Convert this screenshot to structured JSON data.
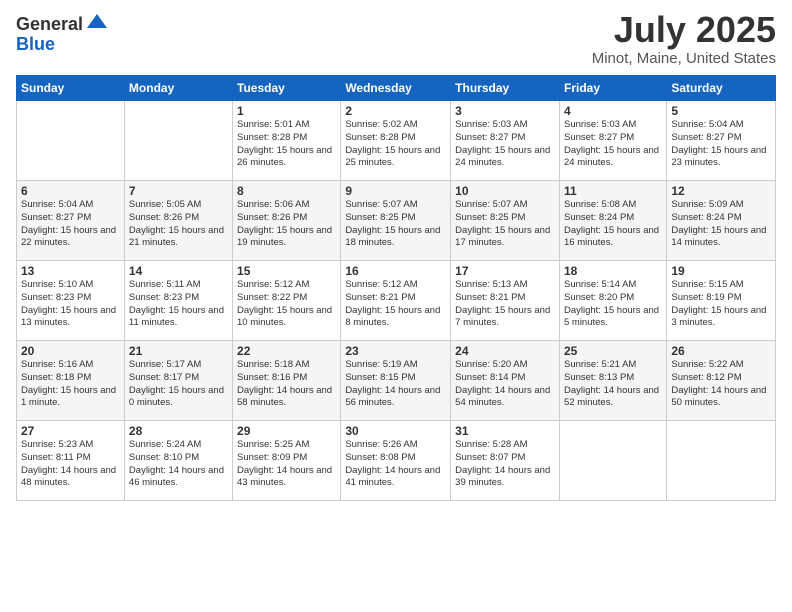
{
  "logo": {
    "general": "General",
    "blue": "Blue"
  },
  "title": {
    "month": "July 2025",
    "location": "Minot, Maine, United States"
  },
  "weekdays": [
    "Sunday",
    "Monday",
    "Tuesday",
    "Wednesday",
    "Thursday",
    "Friday",
    "Saturday"
  ],
  "weeks": [
    [
      null,
      null,
      {
        "day": "1",
        "sunrise": "5:01 AM",
        "sunset": "8:28 PM",
        "daylight": "15 hours and 26 minutes."
      },
      {
        "day": "2",
        "sunrise": "5:02 AM",
        "sunset": "8:28 PM",
        "daylight": "15 hours and 25 minutes."
      },
      {
        "day": "3",
        "sunrise": "5:03 AM",
        "sunset": "8:27 PM",
        "daylight": "15 hours and 24 minutes."
      },
      {
        "day": "4",
        "sunrise": "5:03 AM",
        "sunset": "8:27 PM",
        "daylight": "15 hours and 24 minutes."
      },
      {
        "day": "5",
        "sunrise": "5:04 AM",
        "sunset": "8:27 PM",
        "daylight": "15 hours and 23 minutes."
      }
    ],
    [
      {
        "day": "6",
        "sunrise": "5:04 AM",
        "sunset": "8:27 PM",
        "daylight": "15 hours and 22 minutes."
      },
      {
        "day": "7",
        "sunrise": "5:05 AM",
        "sunset": "8:26 PM",
        "daylight": "15 hours and 21 minutes."
      },
      {
        "day": "8",
        "sunrise": "5:06 AM",
        "sunset": "8:26 PM",
        "daylight": "15 hours and 19 minutes."
      },
      {
        "day": "9",
        "sunrise": "5:07 AM",
        "sunset": "8:25 PM",
        "daylight": "15 hours and 18 minutes."
      },
      {
        "day": "10",
        "sunrise": "5:07 AM",
        "sunset": "8:25 PM",
        "daylight": "15 hours and 17 minutes."
      },
      {
        "day": "11",
        "sunrise": "5:08 AM",
        "sunset": "8:24 PM",
        "daylight": "15 hours and 16 minutes."
      },
      {
        "day": "12",
        "sunrise": "5:09 AM",
        "sunset": "8:24 PM",
        "daylight": "15 hours and 14 minutes."
      }
    ],
    [
      {
        "day": "13",
        "sunrise": "5:10 AM",
        "sunset": "8:23 PM",
        "daylight": "15 hours and 13 minutes."
      },
      {
        "day": "14",
        "sunrise": "5:11 AM",
        "sunset": "8:23 PM",
        "daylight": "15 hours and 11 minutes."
      },
      {
        "day": "15",
        "sunrise": "5:12 AM",
        "sunset": "8:22 PM",
        "daylight": "15 hours and 10 minutes."
      },
      {
        "day": "16",
        "sunrise": "5:12 AM",
        "sunset": "8:21 PM",
        "daylight": "15 hours and 8 minutes."
      },
      {
        "day": "17",
        "sunrise": "5:13 AM",
        "sunset": "8:21 PM",
        "daylight": "15 hours and 7 minutes."
      },
      {
        "day": "18",
        "sunrise": "5:14 AM",
        "sunset": "8:20 PM",
        "daylight": "15 hours and 5 minutes."
      },
      {
        "day": "19",
        "sunrise": "5:15 AM",
        "sunset": "8:19 PM",
        "daylight": "15 hours and 3 minutes."
      }
    ],
    [
      {
        "day": "20",
        "sunrise": "5:16 AM",
        "sunset": "8:18 PM",
        "daylight": "15 hours and 1 minute."
      },
      {
        "day": "21",
        "sunrise": "5:17 AM",
        "sunset": "8:17 PM",
        "daylight": "15 hours and 0 minutes."
      },
      {
        "day": "22",
        "sunrise": "5:18 AM",
        "sunset": "8:16 PM",
        "daylight": "14 hours and 58 minutes."
      },
      {
        "day": "23",
        "sunrise": "5:19 AM",
        "sunset": "8:15 PM",
        "daylight": "14 hours and 56 minutes."
      },
      {
        "day": "24",
        "sunrise": "5:20 AM",
        "sunset": "8:14 PM",
        "daylight": "14 hours and 54 minutes."
      },
      {
        "day": "25",
        "sunrise": "5:21 AM",
        "sunset": "8:13 PM",
        "daylight": "14 hours and 52 minutes."
      },
      {
        "day": "26",
        "sunrise": "5:22 AM",
        "sunset": "8:12 PM",
        "daylight": "14 hours and 50 minutes."
      }
    ],
    [
      {
        "day": "27",
        "sunrise": "5:23 AM",
        "sunset": "8:11 PM",
        "daylight": "14 hours and 48 minutes."
      },
      {
        "day": "28",
        "sunrise": "5:24 AM",
        "sunset": "8:10 PM",
        "daylight": "14 hours and 46 minutes."
      },
      {
        "day": "29",
        "sunrise": "5:25 AM",
        "sunset": "8:09 PM",
        "daylight": "14 hours and 43 minutes."
      },
      {
        "day": "30",
        "sunrise": "5:26 AM",
        "sunset": "8:08 PM",
        "daylight": "14 hours and 41 minutes."
      },
      {
        "day": "31",
        "sunrise": "5:28 AM",
        "sunset": "8:07 PM",
        "daylight": "14 hours and 39 minutes."
      },
      null,
      null
    ]
  ],
  "labels": {
    "sunrise_prefix": "Sunrise: ",
    "sunset_prefix": "Sunset: ",
    "daylight_prefix": "Daylight: "
  }
}
